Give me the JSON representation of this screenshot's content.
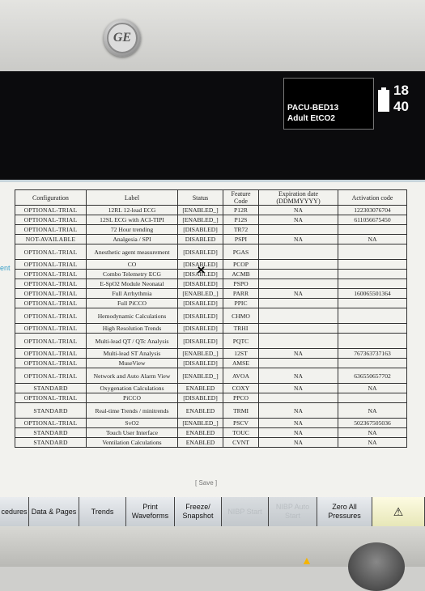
{
  "status": {
    "bed": "PACU-BED13",
    "mode": "Adult EtCO2",
    "clock": "18 40"
  },
  "logo": "GE",
  "side_label": "ent",
  "table": {
    "headers": [
      "Configuration",
      "Label",
      "Status",
      "Feature Code",
      "Expiration date (DDMMYYYY)",
      "Activation code"
    ],
    "rows": [
      [
        "OPTIONAL-TRIAL",
        "12RL 12-lead ECG",
        "[ENABLED_]",
        "P12R",
        "NA",
        "122303076704"
      ],
      [
        "OPTIONAL-TRIAL",
        "12SL ECG with ACI-TIPI",
        "[ENABLED_]",
        "P12S",
        "NA",
        "611056675450"
      ],
      [
        "OPTIONAL-TRIAL",
        "72 Hour trending",
        "[DISABLED]",
        "TR72",
        "",
        ""
      ],
      [
        "NOT-AVAILABLE",
        "Analgesia / SPI",
        "DISABLED",
        "PSPI",
        "NA",
        "NA"
      ],
      [
        "OPTIONAL-TRIAL",
        "Anesthetic agent measurement",
        "[DISABLED]",
        "PGAS",
        "",
        ""
      ],
      [
        "OPTIONAL-TRIAL",
        "CO",
        "[DISABLED]",
        "PCOP",
        "",
        ""
      ],
      [
        "OPTIONAL-TRIAL",
        "Combo Telemetry ECG",
        "[DISABLED]",
        "ACMB",
        "",
        ""
      ],
      [
        "OPTIONAL-TRIAL",
        "E-SpO2 Module Neonatal",
        "[DISABLED]",
        "PSPO",
        "",
        ""
      ],
      [
        "OPTIONAL-TRIAL",
        "Full Arrhythmia",
        "[ENABLED_]",
        "PARR",
        "NA",
        "160065501364"
      ],
      [
        "OPTIONAL-TRIAL",
        "Full PiCCO",
        "[DISABLED]",
        "PPIC",
        "",
        ""
      ],
      [
        "OPTIONAL-TRIAL",
        "Hemodynamic Calculations",
        "[DISABLED]",
        "CHMO",
        "",
        ""
      ],
      [
        "OPTIONAL-TRIAL",
        "High Resolution Trends",
        "[DISABLED]",
        "TRHI",
        "",
        ""
      ],
      [
        "OPTIONAL-TRIAL",
        "Multi-lead QT / QTc Analysis",
        "[DISABLED]",
        "PQTC",
        "",
        ""
      ],
      [
        "OPTIONAL-TRIAL",
        "Multi-lead ST Analysis",
        "[ENABLED_]",
        "12ST",
        "NA",
        "767363737163"
      ],
      [
        "OPTIONAL-TRIAL",
        "MuseView",
        "[DISABLED]",
        "AMSE",
        "",
        ""
      ],
      [
        "OPTIONAL-TRIAL",
        "Network and Auto Alarm View",
        "[ENABLED_]",
        "AVOA",
        "NA",
        "636550657702"
      ],
      [
        "STANDARD",
        "Oxygenation Calculations",
        "ENABLED",
        "COXY",
        "NA",
        "NA"
      ],
      [
        "OPTIONAL-TRIAL",
        "PiCCO",
        "[DISABLED]",
        "PPCO",
        "",
        ""
      ],
      [
        "STANDARD",
        "Real-time Trends / minitrends",
        "ENABLED",
        "TRMI",
        "NA",
        "NA"
      ],
      [
        "OPTIONAL-TRIAL",
        "SvO2",
        "[ENABLED_]",
        "PSCV",
        "NA",
        "502367505036"
      ],
      [
        "STANDARD",
        "Touch User Interface",
        "ENABLED",
        "TOUC",
        "NA",
        "NA"
      ],
      [
        "STANDARD",
        "Ventilation Calculations",
        "ENABLED",
        "CVNT",
        "NA",
        "NA"
      ]
    ],
    "tall_rows": [
      4,
      10,
      12,
      15,
      18
    ],
    "save_label": "[ Save ]"
  },
  "buttons": [
    {
      "label": "cedures",
      "enabled": true
    },
    {
      "label": "Data & Pages",
      "enabled": true
    },
    {
      "label": "Trends",
      "enabled": true
    },
    {
      "label": "Print Waveforms",
      "enabled": true
    },
    {
      "label": "Freeze/ Snapshot",
      "enabled": true
    },
    {
      "label": "NIBP Start",
      "enabled": false
    },
    {
      "label": "NIBP Auto Start",
      "enabled": false
    },
    {
      "label": "Zero All Pressures",
      "enabled": true
    },
    {
      "label": "⚠",
      "enabled": true
    }
  ]
}
